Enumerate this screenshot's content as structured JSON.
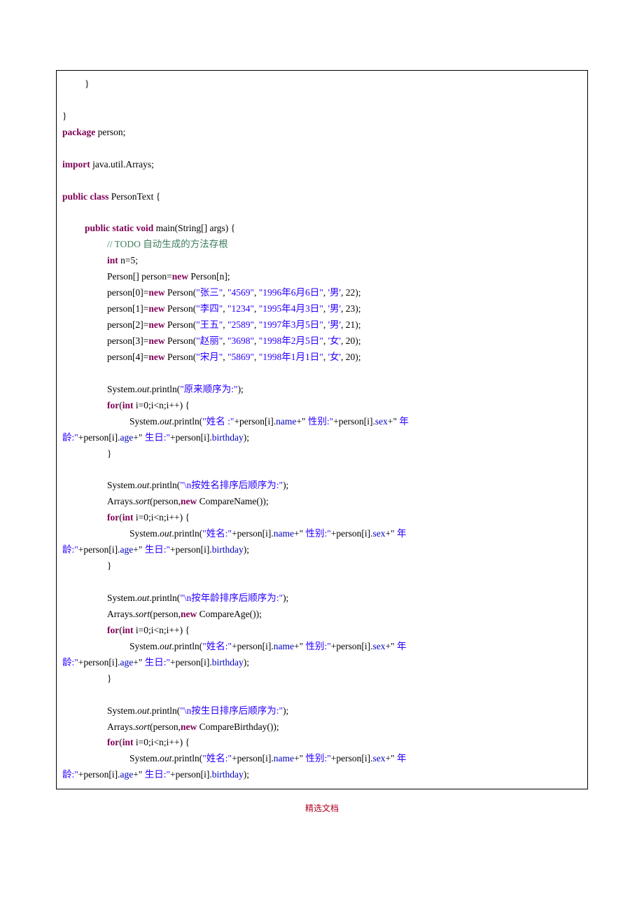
{
  "footer": "精选文档",
  "kw": {
    "package": "package",
    "import": "import",
    "public": "public",
    "class": "class",
    "static": "static",
    "void": "void",
    "int": "int",
    "new": "new",
    "for": "for"
  },
  "txt": {
    "brace_close": "}",
    "pkg_name": " person;",
    "import_arr": " java.util.Arrays;",
    "class_sig": " PersonText {",
    "main_sig": " main(String[] args) {",
    "comment": "// TODO 自动生成的方法存根",
    "n_decl": " n=5;",
    "arr_decl_a": "Person[] person=",
    "arr_decl_b": " Person[n];",
    "sys": "System.",
    "out": "out",
    "println_open": ".println(",
    "arr_sort": "Arrays.",
    "sort": "sort",
    "sort_name": "(person,",
    "sort_name_b": " CompareName());",
    "sort_age_b": " CompareAge());",
    "sort_bd_b": " CompareBirthday());",
    "for_sig_a": "(",
    "for_sig_b": " i=0;i<n;i++) {",
    "wrap_age": "龄:\"",
    "wrap_plus": "+person[i].",
    "wrap_age_fld": "age",
    "wrap_bd_plus": "+\"",
    "wrap_bd_lbl": " 生日:\"",
    "wrap_bd2": "+person[i].",
    "wrap_bd_fld": "birthday",
    "wrap_tail": ");",
    "pr_name_open": "\"",
    "pr_name_lbl_first": "姓名 :\"",
    "pr_name_lbl": "姓名:\"",
    "pr_name_plus": "+person[i].",
    "pr_name_fld": "name",
    "pr_sex_plus": "+\"",
    "pr_sex_lbl": " 性别:\"",
    "pr_sex2": "+person[i].",
    "pr_sex_fld": "sex",
    "pr_age_plus": "+\"",
    "pr_age_lbl": " 年"
  },
  "str": {
    "title_orig": "\"原来顺序为:\"",
    "title_name": "\"\\n按姓名排序后顺序为:\"",
    "title_age": "\"\\n按年龄排序后顺序为:\"",
    "title_bd": "\"\\n按生日排序后顺序为:\""
  },
  "persons": [
    {
      "idx": "0",
      "name": "\"张三\"",
      "id": "\"4569\"",
      "bd": "\"1996年6月6日\"",
      "sex": "'男'",
      "age": "22"
    },
    {
      "idx": "1",
      "name": "\"李四\"",
      "id": "\"1234\"",
      "bd": "\"1995年4月3日\"",
      "sex": "'男'",
      "age": "23"
    },
    {
      "idx": "2",
      "name": "\"王五\"",
      "id": "\"2589\"",
      "bd": "\"1997年3月5日\"",
      "sex": "'男'",
      "age": "21"
    },
    {
      "idx": "3",
      "name": "\"赵丽\"",
      "id": "\"3698\"",
      "bd": "\"1998年2月5日\"",
      "sex": "'女'",
      "age": "20"
    },
    {
      "idx": "4",
      "name": "\"宋月\"",
      "id": "\"5869\"",
      "bd": "\"1998年1月1日\"",
      "sex": "'女'",
      "age": "20"
    }
  ]
}
